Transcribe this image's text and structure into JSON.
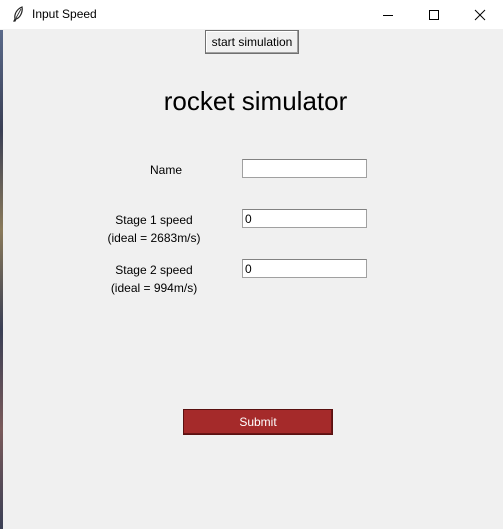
{
  "window": {
    "title": "Input Speed"
  },
  "toolbar": {
    "start_label": "start simulation"
  },
  "heading": "rocket simulator",
  "form": {
    "name_label": "Name",
    "name_value": "",
    "stage1_label": "Stage 1 speed",
    "stage1_hint": "(ideal = 2683m/s)",
    "stage1_value": "0",
    "stage2_label": "Stage 2 speed",
    "stage2_hint": "(ideal = 994m/s)",
    "stage2_value": "0",
    "submit_label": "Submit"
  },
  "colors": {
    "submit_bg": "#a52a2a",
    "window_bg": "#f0f0f0"
  }
}
